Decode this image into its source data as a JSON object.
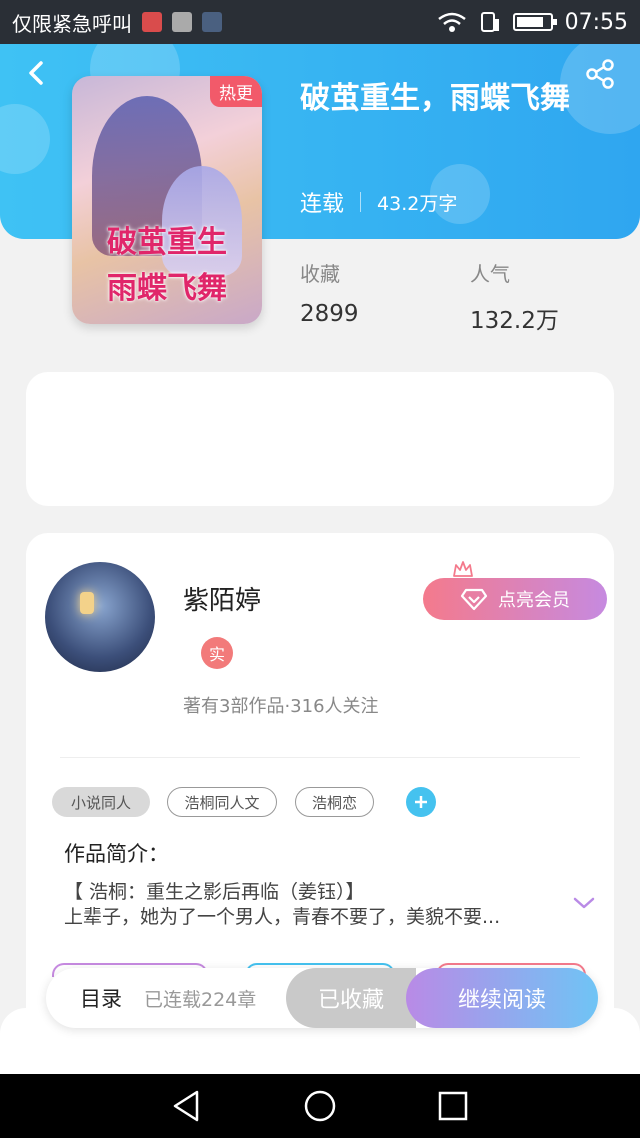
{
  "status_bar": {
    "carrier_text": "仅限紧急呼叫",
    "time": "07:55",
    "icons": [
      "hms-icon",
      "gallery-icon",
      "app-icon",
      "wifi-icon",
      "sim-icon",
      "battery-icon"
    ]
  },
  "header": {
    "hot_badge": "热更",
    "cover_title_line1": "破茧重生",
    "cover_title_line2": "雨蝶飞舞",
    "title": "破茧重生，雨蝶飞舞",
    "status": "连载",
    "word_count": "43.2万字",
    "stats": [
      {
        "label": "收藏",
        "value": "2899"
      },
      {
        "label": "人气",
        "value": "132.2万"
      }
    ]
  },
  "author": {
    "name": "紫陌婷",
    "badge": "实",
    "meta": "著有3部作品·316人关注",
    "vip_label": "点亮会员"
  },
  "tags": [
    {
      "label": "小说同人",
      "style": "filled"
    },
    {
      "label": "浩桐同人文",
      "style": "outline"
    },
    {
      "label": "浩桐恋",
      "style": "outline"
    }
  ],
  "intro": {
    "label": "作品简介：",
    "line1": "【 浩桐：重生之影后再临（姜钰）】",
    "line2": "上辈子，她为了一个男人，青春不要了，美貌不要..."
  },
  "bottom_bar": {
    "toc_label": "目录",
    "chapter_count": "已连载224章",
    "favorited_label": "已收藏",
    "continue_label": "继续阅读"
  },
  "colors": {
    "header_start": "#3fc2f4",
    "header_end": "#2fa6f0",
    "hot_badge": "#f25a6a",
    "accent_blue": "#45c2ef",
    "vip_start": "#f47a8c",
    "vip_end": "#c68ae0"
  }
}
